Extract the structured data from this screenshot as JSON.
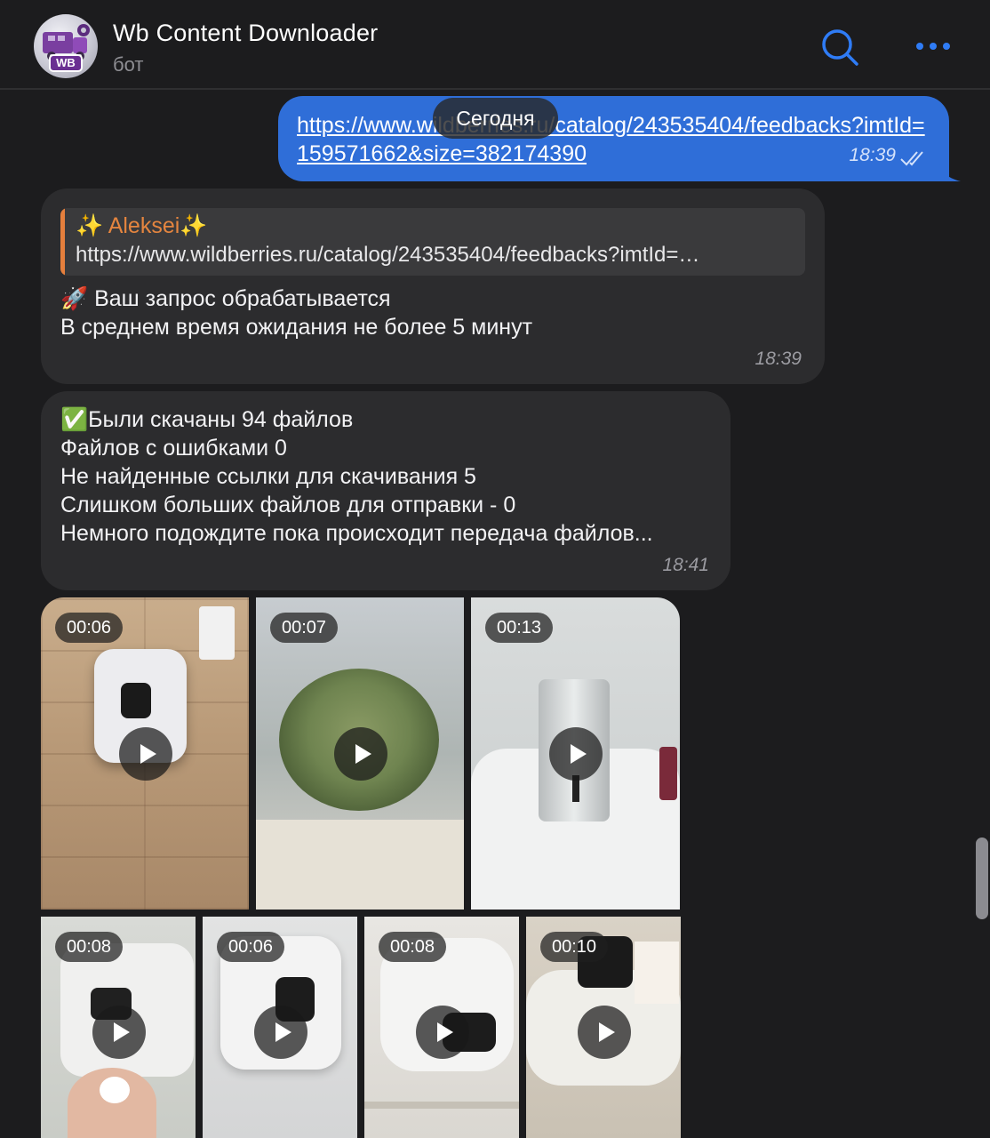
{
  "header": {
    "title": "Wb Content Downloader",
    "subtitle": "бот",
    "avatar_text": "WB"
  },
  "date_divider": "Сегодня",
  "outgoing": {
    "link": "https://www.wildberries.ru/catalog/243535404/feedbacks?imtId=159571662&size=382174390",
    "time": "18:39"
  },
  "reply_message": {
    "quote_author": "✨ Aleksei✨",
    "quote_text": "https://www.wildberries.ru/catalog/243535404/feedbacks?imtId=…",
    "line1": "🚀  Ваш запрос обрабатывается",
    "line2": "В среднем время ожидания не более 5 минут",
    "time": "18:39"
  },
  "status_message": {
    "line1": "✅Были скачаны 94 файлов",
    "line2": "Файлов с ошибками 0",
    "line3": "Не найденные ссылки для скачивания 5",
    "line4": "Слишком больших файлов для отправки - 0",
    "line5": "Немного подождите пока происходит передача файлов...",
    "time": "18:41"
  },
  "videos": [
    {
      "duration": "00:06"
    },
    {
      "duration": "00:07"
    },
    {
      "duration": "00:13"
    },
    {
      "duration": "00:08"
    },
    {
      "duration": "00:06"
    },
    {
      "duration": "00:08"
    },
    {
      "duration": "00:10"
    }
  ],
  "colors": {
    "background": "#1c1c1e",
    "outgoing_bubble": "#2f6ed8",
    "incoming_bubble": "#2c2c2e",
    "accent_blue": "#2f7cf6",
    "quote_author": "#e5853f"
  }
}
